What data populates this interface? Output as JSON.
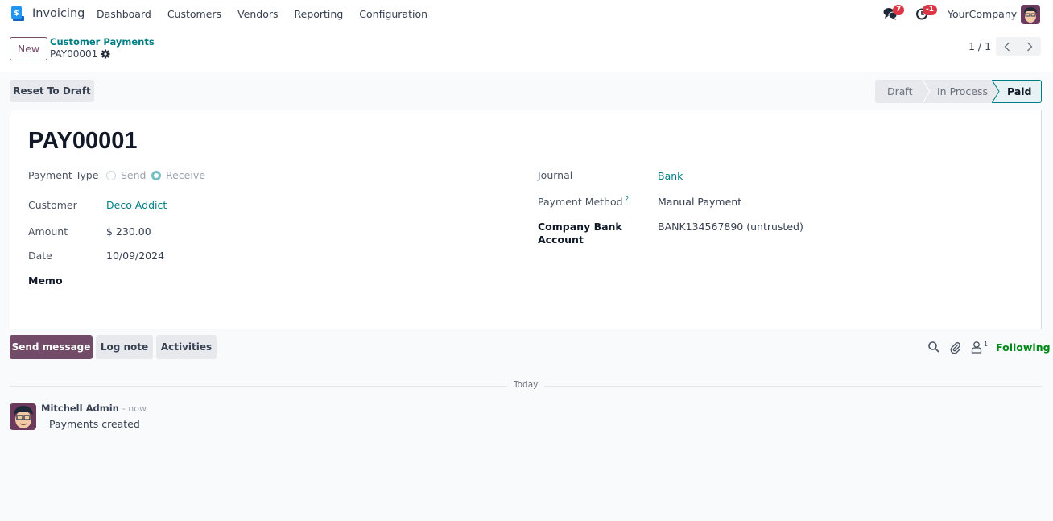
{
  "navbar": {
    "app_name": "Invoicing",
    "menu": [
      "Dashboard",
      "Customers",
      "Vendors",
      "Reporting",
      "Configuration"
    ],
    "messages_badge": "7",
    "activities_badge": "-1",
    "company": "YourCompany"
  },
  "control_panel": {
    "new_label": "New",
    "breadcrumb_parent": "Customer Payments",
    "breadcrumb_current": "PAY00001",
    "pager": "1 / 1"
  },
  "status": {
    "reset_label": "Reset To Draft",
    "stages": [
      "Draft",
      "In Process",
      "Paid"
    ],
    "active_stage": "Paid"
  },
  "form": {
    "title": "PAY00001",
    "payment_type_label": "Payment Type",
    "payment_type_options": [
      "Send",
      "Receive"
    ],
    "payment_type_selected": "Receive",
    "customer_label": "Customer",
    "customer_value": "Deco Addict",
    "amount_label": "Amount",
    "amount_value": "$ 230.00",
    "date_label": "Date",
    "date_value": "10/09/2024",
    "memo_label": "Memo",
    "journal_label": "Journal",
    "journal_value": "Bank",
    "payment_method_label": "Payment Method",
    "payment_method_help": "?",
    "payment_method_value": "Manual Payment",
    "bank_account_label_line1": "Company Bank",
    "bank_account_label_line2": "Account",
    "bank_account_value": "BANK134567890 (untrusted)"
  },
  "chatter": {
    "send_message_label": "Send message",
    "log_note_label": "Log note",
    "activities_label": "Activities",
    "followers_count": "1",
    "following_label": "Following",
    "date_separator": "Today",
    "messages": [
      {
        "author": "Mitchell Admin",
        "time": "- now",
        "body": "Payments created"
      }
    ]
  },
  "colors": {
    "brand": "#714b67",
    "link": "#017e84",
    "following": "#008818",
    "badge": "#dc3545"
  }
}
